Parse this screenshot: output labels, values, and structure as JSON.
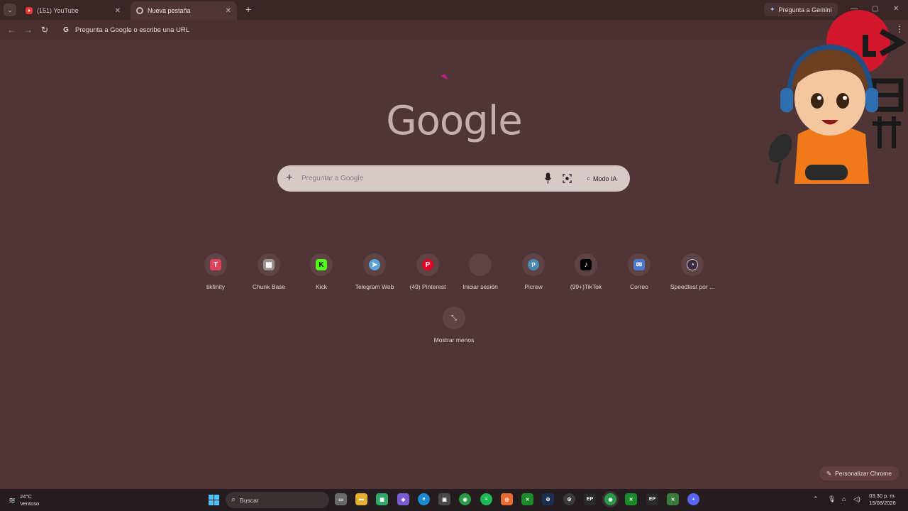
{
  "tabs": [
    {
      "title": "(151) YouTube",
      "active": false
    },
    {
      "title": "Nueva pestaña",
      "active": true
    }
  ],
  "gemini_label": "Pregunta a Gemini",
  "omnibox": {
    "placeholder": "Pregunta a Google o escribe una URL"
  },
  "logo": "Google",
  "search": {
    "placeholder": "Preguntar a Google",
    "ai_mode_label": "Modo IA"
  },
  "shortcuts": [
    {
      "label": "tikfinity",
      "icon": "tikfinity-icon",
      "color": "#e0405a"
    },
    {
      "label": "Chunk Base",
      "icon": "chunkbase-icon",
      "color": "#9a8f8f"
    },
    {
      "label": "Kick",
      "icon": "kick-icon",
      "color": "#53fc18"
    },
    {
      "label": "Telegram Web",
      "icon": "telegram-icon",
      "color": "#5aa2d8"
    },
    {
      "label": "(49) Pinterest",
      "icon": "pinterest-icon",
      "color": "#e60023"
    },
    {
      "label": "Iniciar sesión",
      "icon": "microsoft-icon",
      "color": "#f25022"
    },
    {
      "label": "Picrew",
      "icon": "picrew-icon",
      "color": "#4a8ab0"
    },
    {
      "label": "(99+)TikTok",
      "icon": "tiktok-icon",
      "color": "#000000"
    },
    {
      "label": "Correo",
      "icon": "mail-icon",
      "color": "#4a78d0"
    },
    {
      "label": "Speedtest por ...",
      "icon": "speedtest-icon",
      "color": "#3a2a40"
    }
  ],
  "show_less_label": "Mostrar menos",
  "customize_label": "Personalizar Chrome",
  "taskbar": {
    "weather_temp": "24°C",
    "weather_desc": "Ventoso",
    "search_label": "Buscar",
    "time": "03:30 p. m.",
    "date": "15/08/2026"
  }
}
